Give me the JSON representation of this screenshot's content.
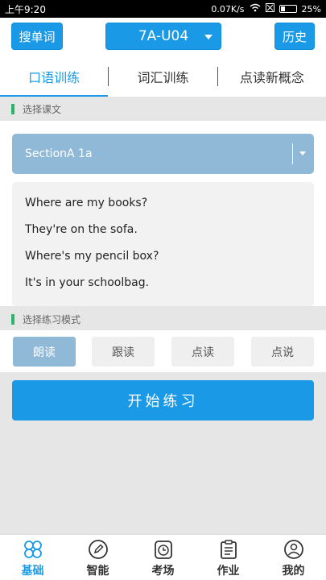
{
  "status": {
    "time": "上午9:20",
    "speed": "0.07K/s",
    "battery": "25%",
    "battery_level": 0.25
  },
  "header": {
    "left_button": "搜单词",
    "unit": "7A-U04",
    "right_button": "历史"
  },
  "tabs": [
    {
      "label": "口语训练",
      "active": true
    },
    {
      "label": "词汇训练",
      "active": false
    },
    {
      "label": "点读新概念",
      "active": false
    }
  ],
  "sections": {
    "choose_text": "选择课文",
    "choose_mode": "选择练习模式"
  },
  "lesson": {
    "selected": "SectionA 1a"
  },
  "text_lines": [
    "Where are my books?",
    "They're on the sofa.",
    "Where's my pencil box?",
    "It's in your schoolbag."
  ],
  "modes": [
    {
      "label": "朗读",
      "active": true
    },
    {
      "label": "跟读",
      "active": false
    },
    {
      "label": "点读",
      "active": false
    },
    {
      "label": "点说",
      "active": false
    }
  ],
  "start_button": "开始练习",
  "nav": [
    {
      "label": "基础",
      "icon": "clover-icon",
      "active": true
    },
    {
      "label": "智能",
      "icon": "pencil-circle-icon",
      "active": false
    },
    {
      "label": "考场",
      "icon": "clock-icon",
      "active": false
    },
    {
      "label": "作业",
      "icon": "clipboard-icon",
      "active": false
    },
    {
      "label": "我的",
      "icon": "user-icon",
      "active": false
    }
  ],
  "colors": {
    "accent": "#1a9ae6",
    "selected_bg": "#90b9d8",
    "section_bar": "#2db36b"
  }
}
